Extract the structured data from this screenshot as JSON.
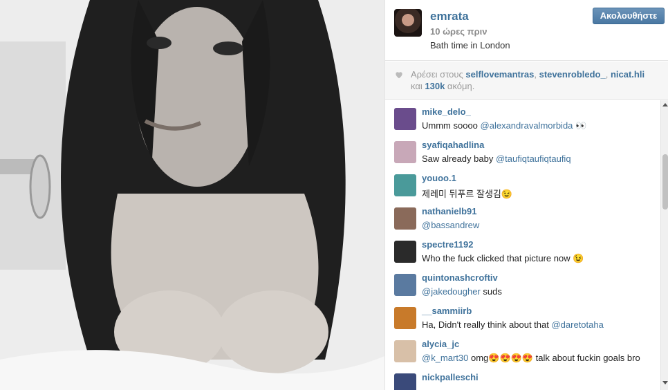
{
  "post": {
    "username": "emrata",
    "time_ago": "10 ώρες πριν",
    "caption": "Bath time in London",
    "follow_label": "Ακολουθήστε"
  },
  "likes": {
    "prefix": "Αρέσει στους",
    "users": [
      "selflovemantras",
      "stevenrobledo_",
      "nicat.hli"
    ],
    "and": "και",
    "more_count": "130k",
    "suffix": "ακόμη."
  },
  "comments": [
    {
      "user": "mike_delo_",
      "parts": [
        {
          "t": "Ummm soooo "
        },
        {
          "m": "@alexandravalmorbida"
        },
        {
          "t": " 👀"
        }
      ],
      "avatar": "#6a4c8c"
    },
    {
      "user": "syafiqahadlina",
      "parts": [
        {
          "t": "Saw already baby "
        },
        {
          "m": "@taufiqtaufiqtaufiq"
        }
      ],
      "avatar": "#c8a8b8"
    },
    {
      "user": "youoo.1",
      "parts": [
        {
          "t": "제레미 뒤푸르 잘생김😉"
        }
      ],
      "avatar": "#4a9a9a"
    },
    {
      "user": "nathanielb91",
      "parts": [
        {
          "m": "@bassandrew"
        }
      ],
      "avatar": "#8a6a5a"
    },
    {
      "user": "spectre1192",
      "parts": [
        {
          "t": "Who the fuck clicked that picture now 😉"
        }
      ],
      "avatar": "#2a2a2a"
    },
    {
      "user": "quintonashcroftiv",
      "parts": [
        {
          "m": "@jakedougher"
        },
        {
          "t": " suds"
        }
      ],
      "avatar": "#5a7aa0"
    },
    {
      "user": "__sammiirb",
      "parts": [
        {
          "t": "Ha, Didn't really think about that "
        },
        {
          "m": "@daretotaha"
        }
      ],
      "avatar": "#c87a2a"
    },
    {
      "user": "alycia_jc",
      "parts": [
        {
          "m": "@k_mart30"
        },
        {
          "t": " omg😍😍😍😍 talk about fuckin goals bro"
        }
      ],
      "avatar": "#d8c0a8"
    },
    {
      "user": "nickpalleschi",
      "parts": [
        {
          "t": ""
        }
      ],
      "avatar": "#3a4a7a"
    }
  ],
  "icons": {
    "heart": "heart-icon",
    "scroll_up": "scroll-up-arrow-icon",
    "scroll_down": "scroll-down-arrow-icon"
  },
  "colors": {
    "link": "#3f729b",
    "button": "#4a78a3",
    "muted": "#999999"
  }
}
